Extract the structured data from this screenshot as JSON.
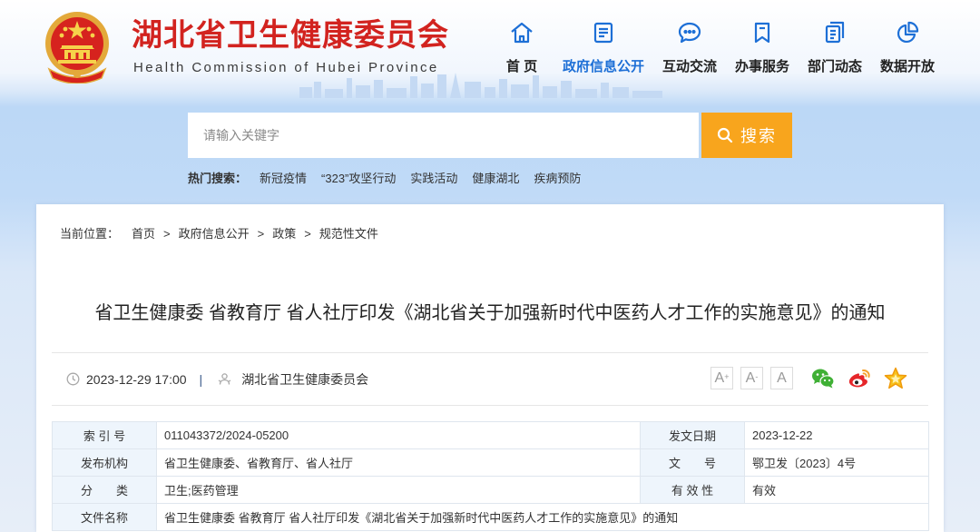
{
  "header": {
    "site_title": "湖北省卫生健康委员会",
    "site_subtitle": "Health Commission of Hubei Province",
    "emblem_icon": "national-emblem-icon",
    "nav": [
      {
        "label": "首 页",
        "icon": "home-icon",
        "active": false
      },
      {
        "label": "政府信息公开",
        "icon": "document-list-icon",
        "active": true
      },
      {
        "label": "互动交流",
        "icon": "chat-bubble-icon",
        "active": false
      },
      {
        "label": "办事服务",
        "icon": "bookmark-icon",
        "active": false
      },
      {
        "label": "部门动态",
        "icon": "news-icon",
        "active": false
      },
      {
        "label": "数据开放",
        "icon": "pie-chart-icon",
        "active": false
      }
    ]
  },
  "search": {
    "placeholder": "请输入关键字",
    "value": "",
    "button_label": "搜索",
    "button_icon": "search-icon",
    "hot_label": "热门搜索：",
    "hot_items": [
      "新冠疫情",
      "“323”攻坚行动",
      "实践活动",
      "健康湖北",
      "疾病预防"
    ]
  },
  "breadcrumb": {
    "label": "当前位置：",
    "separator": ">",
    "items": [
      "首页",
      "政府信息公开",
      "政策",
      "规范性文件"
    ]
  },
  "article": {
    "title": "省卫生健康委 省教育厅 省人社厅印发《湖北省关于加强新时代中医药人才工作的实施意见》的通知",
    "date": "2023-12-29 17:00",
    "date_icon": "clock-icon",
    "meta_separator": "|",
    "source": "湖北省卫生健康委员会",
    "source_icon": "publisher-icon",
    "font_sizes": [
      {
        "base": "A",
        "mark": "+"
      },
      {
        "base": "A",
        "mark": "-"
      },
      {
        "base": "A",
        "mark": ""
      }
    ],
    "share_icons": [
      "wechat-icon",
      "weibo-icon",
      "favorite-star-icon"
    ]
  },
  "info_table": {
    "rows": [
      {
        "label1": "索 引 号",
        "value1": "011043372/2024-05200",
        "label2": "发文日期",
        "value2": "2023-12-22"
      },
      {
        "label1": "发布机构",
        "value1": "省卫生健康委、省教育厅、省人社厅",
        "label2": "文　　号",
        "value2": "鄂卫发〔2023〕4号"
      },
      {
        "label1": "分　　类",
        "value1": "卫生;医药管理",
        "label2": "有 效 性",
        "value2": "有效"
      },
      {
        "label1": "文件名称",
        "value1": "省卫生健康委 省教育厅 省人社厅印发《湖北省关于加强新时代中医药人才工作的实施意见》的通知"
      }
    ]
  },
  "colors": {
    "site_title": "#d2231f",
    "accent_blue": "#1d6fd6",
    "search_button": "#f8a51d",
    "table_label_bg": "#eef5fc",
    "wechat_green": "#3fb035",
    "weibo_red": "#e6262a",
    "star_yellow": "#f7c21c"
  }
}
